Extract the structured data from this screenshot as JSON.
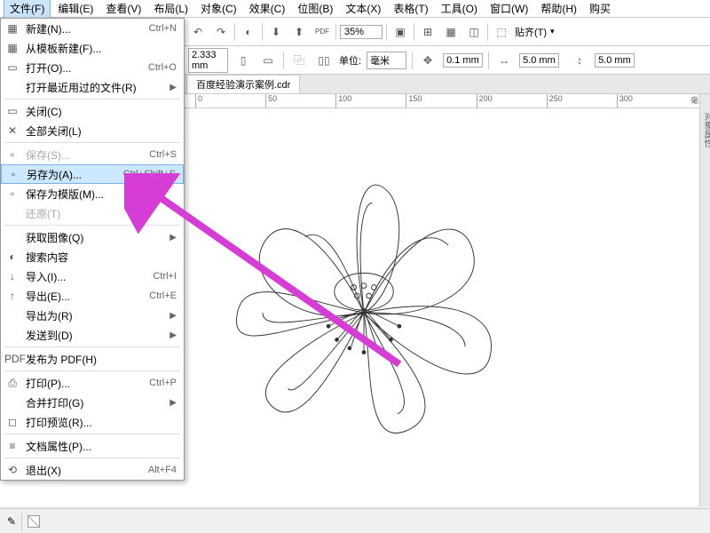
{
  "menubar": {
    "items": [
      "文件(F)",
      "编辑(E)",
      "查看(V)",
      "布局(L)",
      "对象(C)",
      "效果(C)",
      "位图(B)",
      "文本(X)",
      "表格(T)",
      "工具(O)",
      "窗口(W)",
      "帮助(H)",
      "购买"
    ]
  },
  "toolbar": {
    "zoom": "35%",
    "paste": "贴齐(T)"
  },
  "props": {
    "width_val": "2.333 mm",
    "unit_label": "单位:",
    "unit_value": "毫米",
    "nudge": "0.1 mm",
    "dup_x": "5.0 mm",
    "dup_y": "5.0 mm"
  },
  "tab": {
    "title": "百度经验演示案例.cdr"
  },
  "ruler": {
    "ticks": [
      "0",
      "50",
      "100",
      "150",
      "200",
      "250",
      "300"
    ],
    "unit": "毫米"
  },
  "dropdown": {
    "items": [
      {
        "icon": "▦",
        "label": "新建(N)...",
        "shortcut": "Ctrl+N",
        "arrow": false
      },
      {
        "icon": "▦",
        "label": "从模板新建(F)...",
        "shortcut": "",
        "arrow": false
      },
      {
        "icon": "▭",
        "label": "打开(O)...",
        "shortcut": "Ctrl+O",
        "arrow": false
      },
      {
        "icon": "",
        "label": "打开最近用过的文件(R)",
        "shortcut": "",
        "arrow": true
      },
      {
        "sep": true
      },
      {
        "icon": "▭",
        "label": "关闭(C)",
        "shortcut": "",
        "arrow": false
      },
      {
        "icon": "✕",
        "label": "全部关闭(L)",
        "shortcut": "",
        "arrow": false
      },
      {
        "sep": true
      },
      {
        "icon": "▫",
        "label": "保存(S)...",
        "shortcut": "Ctrl+S",
        "arrow": false,
        "disabled": true
      },
      {
        "icon": "▫",
        "label": "另存为(A)...",
        "shortcut": "Ctrl+Shift+S",
        "arrow": false,
        "highlighted": true
      },
      {
        "icon": "▫",
        "label": "保存为模版(M)...",
        "shortcut": "",
        "arrow": false
      },
      {
        "icon": "",
        "label": "还原(T)",
        "shortcut": "",
        "arrow": false,
        "disabled": true
      },
      {
        "sep": true
      },
      {
        "icon": "",
        "label": "获取图像(Q)",
        "shortcut": "",
        "arrow": true
      },
      {
        "icon": "◐",
        "label": "搜索内容",
        "shortcut": "",
        "arrow": false
      },
      {
        "icon": "↓",
        "label": "导入(I)...",
        "shortcut": "Ctrl+I",
        "arrow": false
      },
      {
        "icon": "↑",
        "label": "导出(E)...",
        "shortcut": "Ctrl+E",
        "arrow": false
      },
      {
        "icon": "",
        "label": "导出为(R)",
        "shortcut": "",
        "arrow": true
      },
      {
        "icon": "",
        "label": "发送到(D)",
        "shortcut": "",
        "arrow": true
      },
      {
        "sep": true
      },
      {
        "icon": "PDF",
        "label": "发布为 PDF(H)",
        "shortcut": "",
        "arrow": false
      },
      {
        "sep": true
      },
      {
        "icon": "⎙",
        "label": "打印(P)...",
        "shortcut": "Ctrl+P",
        "arrow": false
      },
      {
        "icon": "",
        "label": "合并打印(G)",
        "shortcut": "",
        "arrow": true
      },
      {
        "icon": "◻",
        "label": "打印预览(R)...",
        "shortcut": "",
        "arrow": false
      },
      {
        "sep": true
      },
      {
        "icon": "≡",
        "label": "文档属性(P)...",
        "shortcut": "",
        "arrow": false
      },
      {
        "sep": true
      },
      {
        "icon": "⟲",
        "label": "退出(X)",
        "shortcut": "Alt+F4",
        "arrow": false
      }
    ]
  },
  "sidepanel": {
    "label": "对象属性"
  }
}
